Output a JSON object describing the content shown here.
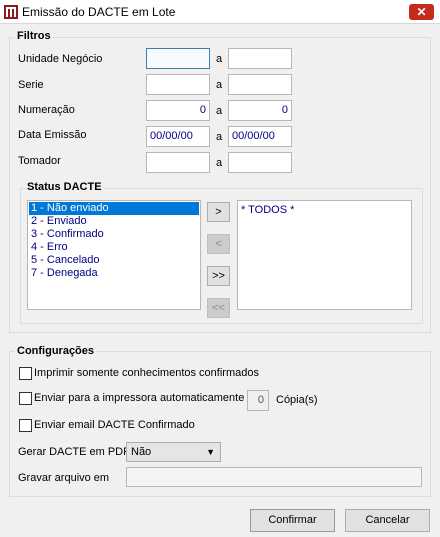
{
  "window": {
    "title": "Emissão do DACTE em Lote",
    "close_glyph": "✕"
  },
  "filtros": {
    "group_title": "Filtros",
    "range_separator": "a",
    "rows": [
      {
        "label": "Unidade Negócio",
        "from": "",
        "to": ""
      },
      {
        "label": "Serie",
        "from": "",
        "to": ""
      },
      {
        "label": "Numeração",
        "from": "0",
        "to": "0"
      },
      {
        "label": "Data Emissão",
        "from": "00/00/00",
        "to": "00/00/00"
      },
      {
        "label": "Tomador",
        "from": "",
        "to": ""
      }
    ]
  },
  "status": {
    "group_title": "Status DACTE",
    "available": [
      "1 - Não enviado",
      "2 - Enviado",
      "3 - Confirmado",
      "4 - Erro",
      "5 - Cancelado",
      "7 - Denegada"
    ],
    "selected_index": 0,
    "chosen": [
      "* TODOS *"
    ],
    "buttons": {
      "add": ">",
      "remove": "<",
      "add_all": ">>",
      "remove_all": "<<"
    }
  },
  "config": {
    "group_title": "Configurações",
    "only_confirmed": {
      "label": "Imprimir somente conhecimentos confirmados",
      "checked": false
    },
    "send_printer": {
      "label": "Enviar para a impressora automaticamente",
      "checked": false,
      "copies": "0",
      "copies_label": "Cópia(s)"
    },
    "send_email": {
      "label": "Enviar email DACTE Confirmado",
      "checked": false
    },
    "pdf": {
      "label": "Gerar DACTE em PDF",
      "value": "Não"
    },
    "save_file": {
      "label": "Gravar arquivo em",
      "value": ""
    }
  },
  "footer": {
    "confirm_label": "Confirmar",
    "cancel_label": "Cancelar"
  },
  "colors": {
    "title_close": "#c42b1c",
    "selection": "#0078d7",
    "field_text": "#000080"
  }
}
